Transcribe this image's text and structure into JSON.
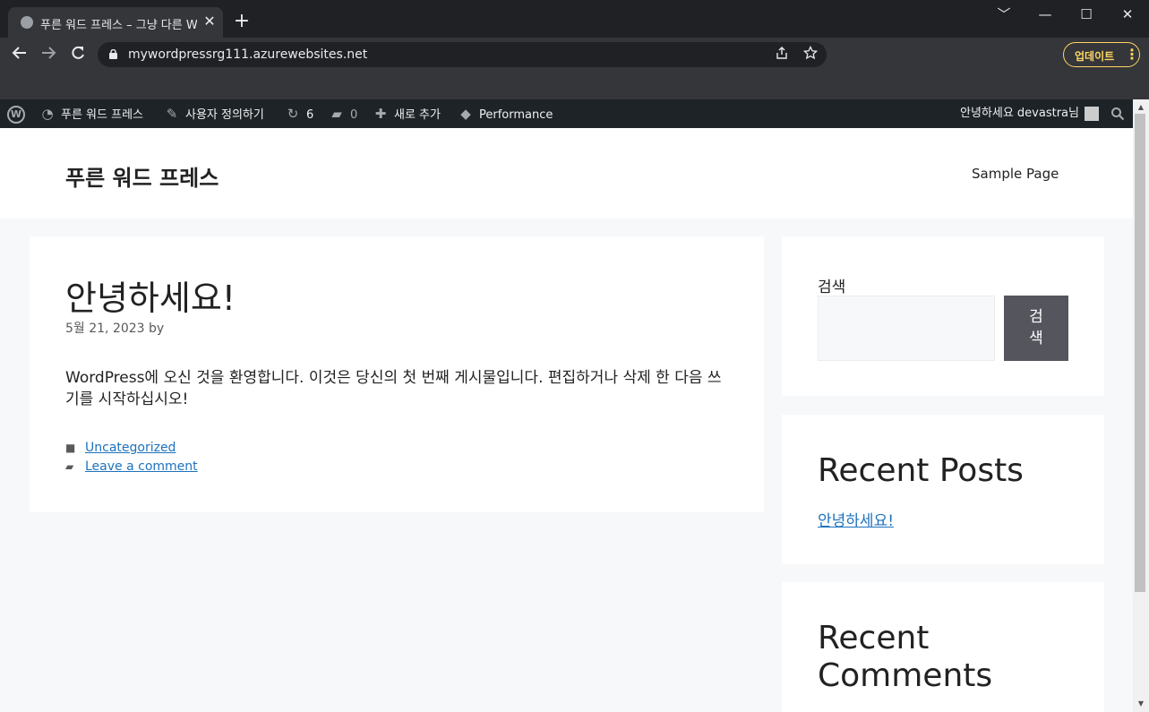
{
  "browser": {
    "tab_title": "푸른 워드 프레스 – 그냥 다른 W",
    "tab_close": "✕",
    "new_tab": "+",
    "url": "mywordpressrg111.azurewebsites.net",
    "update_label": "업데이트",
    "window_controls": [
      "﹀",
      "—",
      "☐",
      "✕"
    ],
    "icons": [
      "back-icon",
      "forward-icon",
      "reload-icon",
      "lock-icon",
      "share-icon",
      "star-icon",
      "kebab-menu-icon"
    ]
  },
  "adminbar": {
    "site_name": "푸른 워드 프레스",
    "customize": "사용자 정의하기",
    "updates_count": "6",
    "comments_count": "0",
    "new_content": "새로 추가",
    "performance": "Performance",
    "greeting": "안녕하세요 devastra님"
  },
  "site": {
    "title": "푸른 워드 프레스",
    "nav": [
      "Sample Page"
    ]
  },
  "post": {
    "title": "안녕하세요!",
    "meta": "5월 21, 2023 by",
    "body": "WordPress에 오신 것을 환영합니다. 이것은 당신의 첫 번째 게시물입니다. 편집하거나 삭제 한 다음 쓰기를 시작하십시오!",
    "category": "Uncategorized",
    "comment_link": "Leave a comment"
  },
  "sidebar": {
    "search_label": "검색",
    "search_button": "검색",
    "recent_posts_heading": "Recent Posts",
    "recent_posts": [
      "안녕하세요!"
    ],
    "recent_comments_heading": "Recent Comments"
  }
}
